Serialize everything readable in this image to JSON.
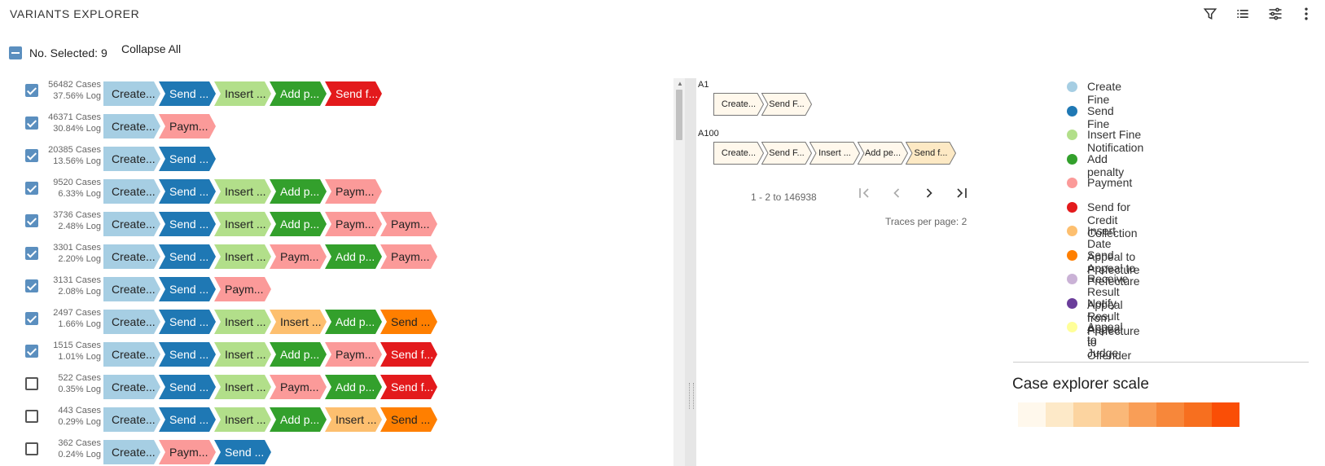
{
  "header": {
    "title": "VARIANTS EXPLORER",
    "icons": [
      "filter-icon",
      "list-icon",
      "sliders-icon",
      "more-vert-icon"
    ]
  },
  "selection": {
    "selected_label": "No. Selected: 9",
    "collapse_label": "Collapse All"
  },
  "activities": {
    "create": {
      "name": "Create Fine",
      "short": "Create...",
      "color": "#a6cee3",
      "text": "#222222"
    },
    "send": {
      "name": "Send Fine",
      "short": "Send ...",
      "color": "#1f78b4",
      "text": "#ffffff"
    },
    "insert": {
      "name": "Insert Fine Notification",
      "short": "Insert ...",
      "color": "#b2df8a",
      "text": "#222222"
    },
    "penalty": {
      "name": "Add penalty",
      "short": "Add p...",
      "color": "#33a02c",
      "text": "#ffffff"
    },
    "payment": {
      "name": "Payment",
      "short": "Paym...",
      "color": "#fb9a99",
      "text": "#222222"
    },
    "credit": {
      "name": "Send for Credit Collection",
      "short": "Send f...",
      "color": "#e31a1c",
      "text": "#ffffff"
    },
    "insertappeal": {
      "name": "Insert Date Appeal to Prefecture",
      "short": "Insert ...",
      "color": "#fdbf6f",
      "text": "#222222"
    },
    "sendappeal": {
      "name": "Send Appeal to Prefecture",
      "short": "Send ...",
      "color": "#ff7f00",
      "text": "#222222"
    },
    "receive": {
      "name": "Receive Result Appeal from Prefecture",
      "short": "",
      "color": "#cab2d6",
      "text": "#222222"
    },
    "notify": {
      "name": "Notify Result Appeal to Offender",
      "short": "",
      "color": "#6a3d9a",
      "text": "#ffffff"
    },
    "judge": {
      "name": "Appeal to Judge",
      "short": "",
      "color": "#ffff99",
      "text": "#222222"
    }
  },
  "variants": [
    {
      "cases": "56482 Cases",
      "log": "37.56% Log",
      "checked": true,
      "steps": [
        "create",
        "send",
        "insert",
        "penalty",
        "credit"
      ]
    },
    {
      "cases": "46371 Cases",
      "log": "30.84% Log",
      "checked": true,
      "steps": [
        "create",
        "payment"
      ]
    },
    {
      "cases": "20385 Cases",
      "log": "13.56% Log",
      "checked": true,
      "steps": [
        "create",
        "send"
      ]
    },
    {
      "cases": "9520 Cases",
      "log": "6.33% Log",
      "checked": true,
      "steps": [
        "create",
        "send",
        "insert",
        "penalty",
        "payment"
      ]
    },
    {
      "cases": "3736 Cases",
      "log": "2.48% Log",
      "checked": true,
      "steps": [
        "create",
        "send",
        "insert",
        "penalty",
        "payment",
        "payment"
      ]
    },
    {
      "cases": "3301 Cases",
      "log": "2.20% Log",
      "checked": true,
      "steps": [
        "create",
        "send",
        "insert",
        "payment",
        "penalty",
        "payment"
      ]
    },
    {
      "cases": "3131 Cases",
      "log": "2.08% Log",
      "checked": true,
      "steps": [
        "create",
        "send",
        "payment"
      ]
    },
    {
      "cases": "2497 Cases",
      "log": "1.66% Log",
      "checked": true,
      "steps": [
        "create",
        "send",
        "insert",
        "insertappeal",
        "penalty",
        "sendappeal"
      ]
    },
    {
      "cases": "1515 Cases",
      "log": "1.01% Log",
      "checked": true,
      "steps": [
        "create",
        "send",
        "insert",
        "penalty",
        "payment",
        "credit"
      ]
    },
    {
      "cases": "522 Cases",
      "log": "0.35% Log",
      "checked": false,
      "steps": [
        "create",
        "send",
        "insert",
        "payment",
        "penalty",
        "credit"
      ]
    },
    {
      "cases": "443 Cases",
      "log": "0.29% Log",
      "checked": false,
      "steps": [
        "create",
        "send",
        "insert",
        "penalty",
        "insertappeal",
        "sendappeal"
      ]
    },
    {
      "cases": "362 Cases",
      "log": "0.24% Log",
      "checked": false,
      "steps": [
        "create",
        "payment",
        "send"
      ]
    }
  ],
  "traces": [
    {
      "id": "A1",
      "steps": [
        {
          "label": "Create...",
          "color": "#fff8ec"
        },
        {
          "label": "Send F...",
          "color": "#fff8ec"
        }
      ]
    },
    {
      "id": "A100",
      "steps": [
        {
          "label": "Create...",
          "color": "#fff8ec"
        },
        {
          "label": "Send F...",
          "color": "#fff8ec"
        },
        {
          "label": "Insert ...",
          "color": "#fff8ec"
        },
        {
          "label": "Add pe...",
          "color": "#fff8ec"
        },
        {
          "label": "Send f...",
          "color": "#fde9c4"
        }
      ]
    }
  ],
  "pager": {
    "range": "1 - 2 to 146938",
    "traces_per_page_label": "Traces per page:",
    "traces_per_page": "2"
  },
  "legend": [
    "create",
    "send",
    "insert",
    "penalty",
    "payment",
    "credit",
    "insertappeal",
    "sendappeal",
    "receive",
    "notify",
    "judge"
  ],
  "scale": {
    "title": "Case explorer scale",
    "colors": [
      "#fff8ec",
      "#fde9c8",
      "#fcd4a0",
      "#fab878",
      "#f99e57",
      "#f7873a",
      "#f76f1f",
      "#fa4e06"
    ]
  }
}
